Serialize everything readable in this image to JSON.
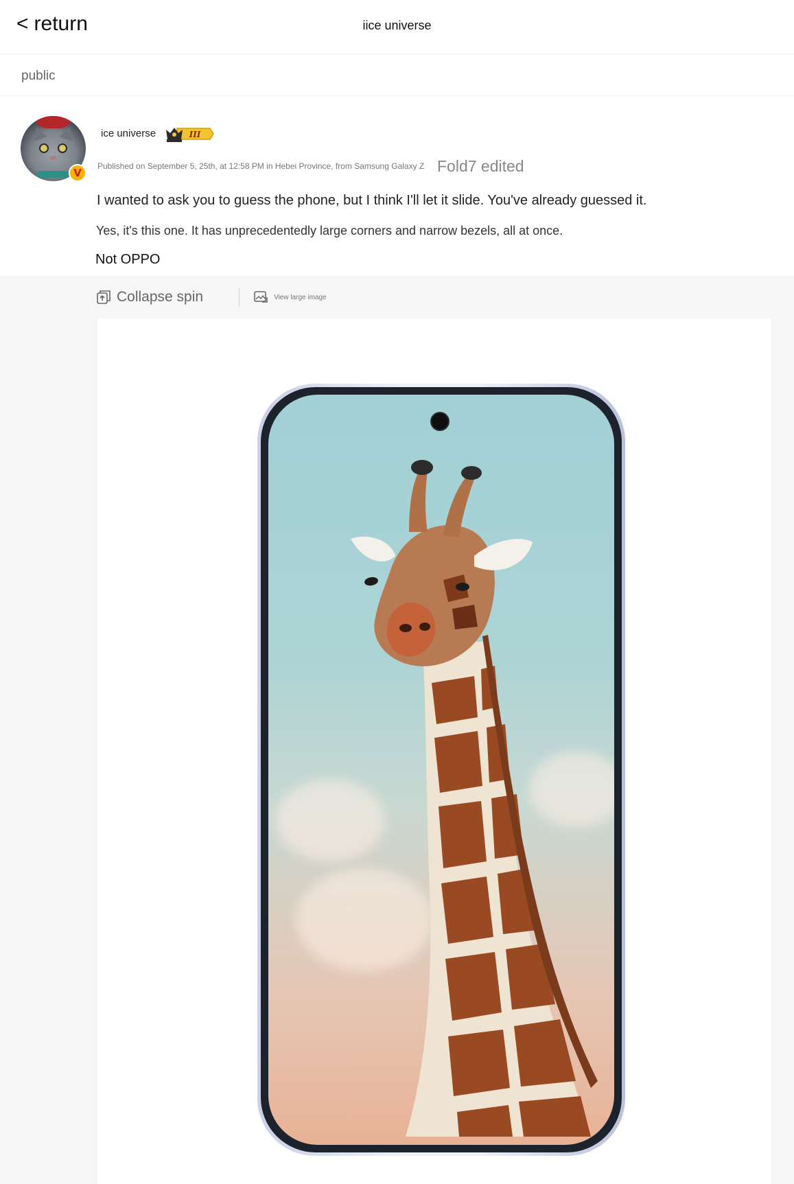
{
  "header": {
    "back_label": "return",
    "back_chevron": "<",
    "title": "iice universe"
  },
  "visibility": {
    "label": "public"
  },
  "post": {
    "author": "ice universe",
    "verified_badge": "V",
    "rank_badge_text": "III",
    "meta": "Published on September 5, 25th, at 12:58 PM in Hebei Province, from Samsung Galaxy Z",
    "meta_edited": "Fold7 edited",
    "text_line_1": "I wanted to ask you to guess the phone, but I think I'll let it slide. You've already guessed it.",
    "text_line_2": "Yes, it's this one. It has unprecedentedly large corners and narrow bezels, all at once.",
    "text_line_3": "Not OPPO"
  },
  "media_toolbar": {
    "collapse_label": "Collapse spin",
    "view_large_label": "View large image"
  },
  "colors": {
    "rank_gold": "#f4c430",
    "verified_bg": "#f7b500",
    "screen_sky": "#a2d0d5",
    "screen_sunset": "#e8b296"
  }
}
